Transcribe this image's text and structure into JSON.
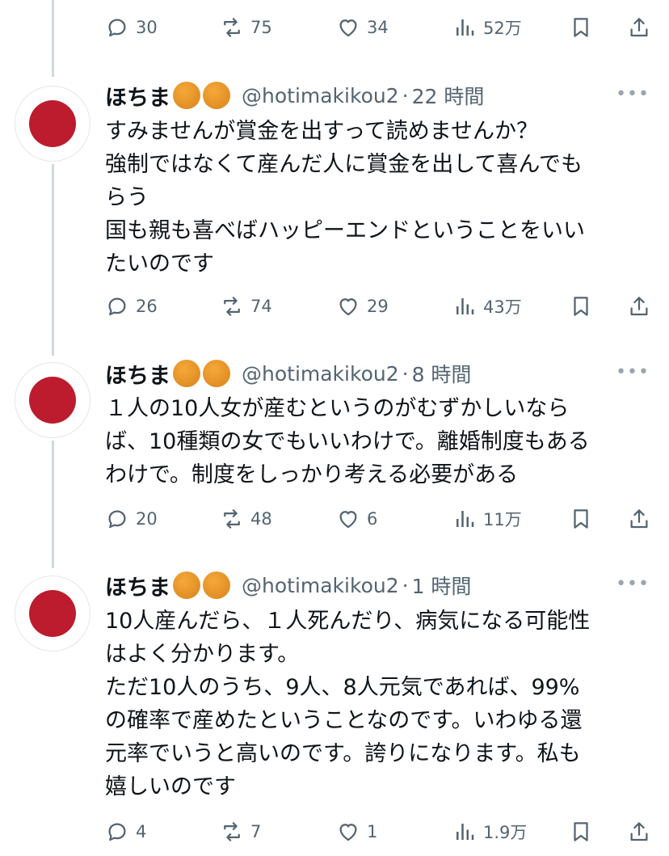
{
  "top_actions": {
    "replies": "30",
    "reposts": "75",
    "likes": "34",
    "views": "52万"
  },
  "tweets": [
    {
      "name": "ほちま",
      "handle": "@hotimakikou2",
      "time": "22 時間",
      "lines": [
        "すみませんが賞金を出すって読めませんか？",
        "強制ではなくて産んだ人に賞金を出して喜んでも",
        "らう",
        "国も親も喜べばハッピーエンドということをいい",
        "たいのです"
      ],
      "replies": "26",
      "reposts": "74",
      "likes": "29",
      "views": "43万"
    },
    {
      "name": "ほちま",
      "handle": "@hotimakikou2",
      "time": "8 時間",
      "lines": [
        "１人の10人女が産むというのがむずかしいなら",
        "ば、10種類の女でもいいわけで。離婚制度もある",
        "わけで。制度をしっかり考える必要がある"
      ],
      "replies": "20",
      "reposts": "48",
      "likes": "6",
      "views": "11万"
    },
    {
      "name": "ほちま",
      "handle": "@hotimakikou2",
      "time": "1 時間",
      "lines": [
        "10人産んだら、１人死んだり、病気になる可能性",
        "はよく分かります。",
        "ただ10人のうち、9人、8人元気であれば、99%",
        "の確率で産めたということなのです。いわゆる還",
        "元率でいうと高いのです。誇りになります。私も",
        "嬉しいのです"
      ],
      "replies": "4",
      "reposts": "7",
      "likes": "1",
      "views": "1.9万"
    }
  ],
  "icons": {
    "reply": "reply-icon",
    "repost": "repost-icon",
    "like": "heart-icon",
    "views": "views-icon",
    "bookmark": "bookmark-icon",
    "share": "share-icon",
    "more": "more-icon",
    "badge": "badge-icon"
  },
  "colors": {
    "avatar_circle": "#bc1c2e",
    "badge": "#e69a2e",
    "secondary_text": "#536471",
    "thread_line": "#cfd9de"
  }
}
